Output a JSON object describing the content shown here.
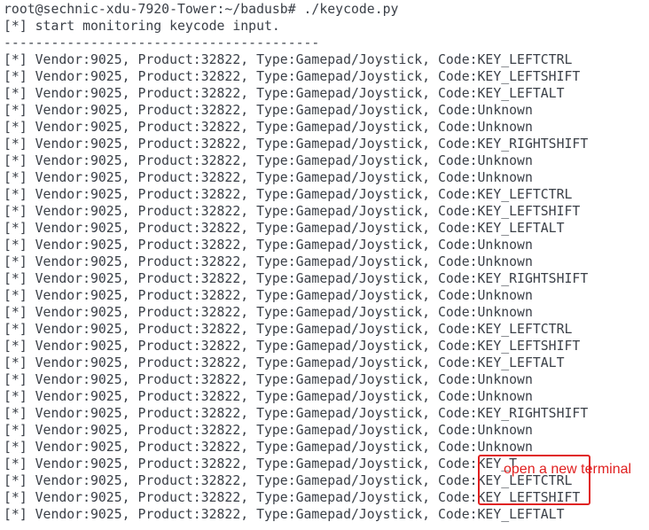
{
  "terminal": {
    "prompt_line": "root@sechnic-xdu-7920-Tower:~/badusb# ./keycode.py",
    "start_line": "[*] start monitoring keycode input.",
    "separator": "----------------------------------------",
    "events": [
      "[*] Vendor:9025, Product:32822, Type:Gamepad/Joystick, Code:KEY_LEFTCTRL",
      "[*] Vendor:9025, Product:32822, Type:Gamepad/Joystick, Code:KEY_LEFTSHIFT",
      "[*] Vendor:9025, Product:32822, Type:Gamepad/Joystick, Code:KEY_LEFTALT",
      "[*] Vendor:9025, Product:32822, Type:Gamepad/Joystick, Code:Unknown",
      "[*] Vendor:9025, Product:32822, Type:Gamepad/Joystick, Code:Unknown",
      "[*] Vendor:9025, Product:32822, Type:Gamepad/Joystick, Code:KEY_RIGHTSHIFT",
      "[*] Vendor:9025, Product:32822, Type:Gamepad/Joystick, Code:Unknown",
      "[*] Vendor:9025, Product:32822, Type:Gamepad/Joystick, Code:Unknown",
      "[*] Vendor:9025, Product:32822, Type:Gamepad/Joystick, Code:KEY_LEFTCTRL",
      "[*] Vendor:9025, Product:32822, Type:Gamepad/Joystick, Code:KEY_LEFTSHIFT",
      "[*] Vendor:9025, Product:32822, Type:Gamepad/Joystick, Code:KEY_LEFTALT",
      "[*] Vendor:9025, Product:32822, Type:Gamepad/Joystick, Code:Unknown",
      "[*] Vendor:9025, Product:32822, Type:Gamepad/Joystick, Code:Unknown",
      "[*] Vendor:9025, Product:32822, Type:Gamepad/Joystick, Code:KEY_RIGHTSHIFT",
      "[*] Vendor:9025, Product:32822, Type:Gamepad/Joystick, Code:Unknown",
      "[*] Vendor:9025, Product:32822, Type:Gamepad/Joystick, Code:Unknown",
      "[*] Vendor:9025, Product:32822, Type:Gamepad/Joystick, Code:KEY_LEFTCTRL",
      "[*] Vendor:9025, Product:32822, Type:Gamepad/Joystick, Code:KEY_LEFTSHIFT",
      "[*] Vendor:9025, Product:32822, Type:Gamepad/Joystick, Code:KEY_LEFTALT",
      "[*] Vendor:9025, Product:32822, Type:Gamepad/Joystick, Code:Unknown",
      "[*] Vendor:9025, Product:32822, Type:Gamepad/Joystick, Code:Unknown",
      "[*] Vendor:9025, Product:32822, Type:Gamepad/Joystick, Code:KEY_RIGHTSHIFT",
      "[*] Vendor:9025, Product:32822, Type:Gamepad/Joystick, Code:Unknown",
      "[*] Vendor:9025, Product:32822, Type:Gamepad/Joystick, Code:Unknown",
      "[*] Vendor:9025, Product:32822, Type:Gamepad/Joystick, Code:KEY_T",
      "[*] Vendor:9025, Product:32822, Type:Gamepad/Joystick, Code:KEY_LEFTCTRL",
      "[*] Vendor:9025, Product:32822, Type:Gamepad/Joystick, Code:KEY_LEFTSHIFT",
      "[*] Vendor:9025, Product:32822, Type:Gamepad/Joystick, Code:KEY_LEFTALT"
    ]
  },
  "annotation": {
    "label": "open a new terminal",
    "color": "#e02020"
  },
  "colors": {
    "background": "#ffffff",
    "text": "#3b4048"
  }
}
